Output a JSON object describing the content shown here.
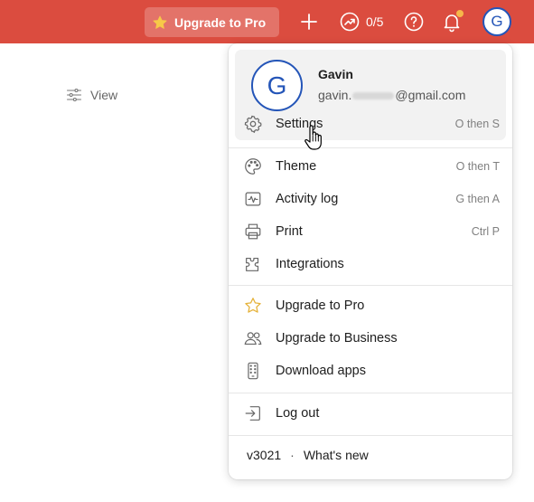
{
  "topbar": {
    "upgrade_label": "Upgrade to Pro",
    "karma": "0/5",
    "avatar_initial": "G",
    "bg_color": "#db4c3f",
    "notification_dot_color": "#f6b74a"
  },
  "view": {
    "label": "View"
  },
  "menu": {
    "profile": {
      "initial": "G",
      "name": "Gavin",
      "email_start": "gavin.",
      "email_end": "@gmail.com"
    },
    "items": [
      {
        "label": "Settings",
        "shortcut": "O then S",
        "icon": "gear-icon"
      },
      {
        "label": "Theme",
        "shortcut": "O then T",
        "icon": "palette-icon"
      },
      {
        "label": "Activity log",
        "shortcut": "G then A",
        "icon": "activity-icon"
      },
      {
        "label": "Print",
        "shortcut": "Ctrl P",
        "icon": "printer-icon"
      },
      {
        "label": "Integrations",
        "shortcut": "",
        "icon": "puzzle-icon"
      },
      {
        "label": "Upgrade to Pro",
        "shortcut": "",
        "icon": "star-icon"
      },
      {
        "label": "Upgrade to Business",
        "shortcut": "",
        "icon": "users-icon"
      },
      {
        "label": "Download apps",
        "shortcut": "",
        "icon": "phone-icon"
      },
      {
        "label": "Log out",
        "shortcut": "",
        "icon": "logout-icon"
      }
    ],
    "footer": {
      "version": "v3021",
      "separator": "·",
      "whats_new": "What's new"
    }
  }
}
